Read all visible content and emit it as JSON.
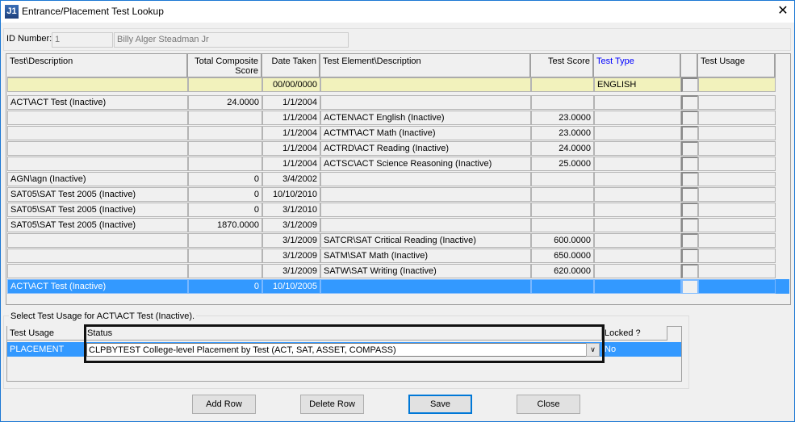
{
  "window": {
    "title": "Entrance/Placement Test Lookup",
    "icon_text": "J1"
  },
  "id": {
    "label": "ID Number:",
    "number": "1",
    "name": "Billy Alger Steadman Jr"
  },
  "grid": {
    "headers": [
      "Test\\Description",
      "Total Composite Score",
      "Date Taken",
      "Test Element\\Description",
      "Test Score",
      "Test Type",
      "",
      "Test Usage"
    ],
    "filter": [
      "",
      "",
      "00/00/0000",
      "",
      "",
      "ENGLISH",
      "",
      ""
    ],
    "rows": [
      [
        "ACT\\ACT Test (Inactive)",
        "24.0000",
        "1/1/2004",
        "",
        "",
        "",
        "",
        ""
      ],
      [
        "",
        "",
        "1/1/2004",
        "ACTEN\\ACT English (Inactive)",
        "23.0000",
        "",
        "",
        ""
      ],
      [
        "",
        "",
        "1/1/2004",
        "ACTMT\\ACT Math (Inactive)",
        "23.0000",
        "",
        "",
        ""
      ],
      [
        "",
        "",
        "1/1/2004",
        "ACTRD\\ACT Reading (Inactive)",
        "24.0000",
        "",
        "",
        ""
      ],
      [
        "",
        "",
        "1/1/2004",
        "ACTSC\\ACT Science Reasoning (Inactive)",
        "25.0000",
        "",
        "",
        ""
      ],
      [
        "AGN\\agn (Inactive)",
        "0",
        "3/4/2002",
        "",
        "",
        "",
        "",
        ""
      ],
      [
        "SAT05\\SAT Test 2005 (Inactive)",
        "0",
        "10/10/2010",
        "",
        "",
        "",
        "",
        ""
      ],
      [
        "SAT05\\SAT Test 2005 (Inactive)",
        "0",
        "3/1/2010",
        "",
        "",
        "",
        "",
        ""
      ],
      [
        "SAT05\\SAT Test 2005 (Inactive)",
        "1870.0000",
        "3/1/2009",
        "",
        "",
        "",
        "",
        ""
      ],
      [
        "",
        "",
        "3/1/2009",
        "SATCR\\SAT Critical Reading (Inactive)",
        "600.0000",
        "",
        "",
        ""
      ],
      [
        "",
        "",
        "3/1/2009",
        "SATM\\SAT Math (Inactive)",
        "650.0000",
        "",
        "",
        ""
      ],
      [
        "",
        "",
        "3/1/2009",
        "SATW\\SAT Writing (Inactive)",
        "620.0000",
        "",
        "",
        ""
      ],
      [
        "ACT\\ACT Test (Inactive)",
        "0",
        "10/10/2005",
        "",
        "",
        "",
        "",
        ""
      ]
    ],
    "selected_row": 12
  },
  "usage": {
    "group_label": "Select Test Usage for ACT\\ACT Test (Inactive).",
    "headers": [
      "Test Usage",
      "Status",
      "Locked ?"
    ],
    "row": {
      "usage": "PLACEMENT",
      "status": "CLPBYTEST College-level Placement by Test (ACT, SAT, ASSET, COMPASS)",
      "locked": "No"
    }
  },
  "buttons": {
    "add": "Add Row",
    "delete": "Delete Row",
    "save": "Save",
    "close": "Close"
  },
  "colors": {
    "selected": "#3399ff",
    "filter": "#f2f2bc",
    "test_type_header": "#0000ff"
  }
}
